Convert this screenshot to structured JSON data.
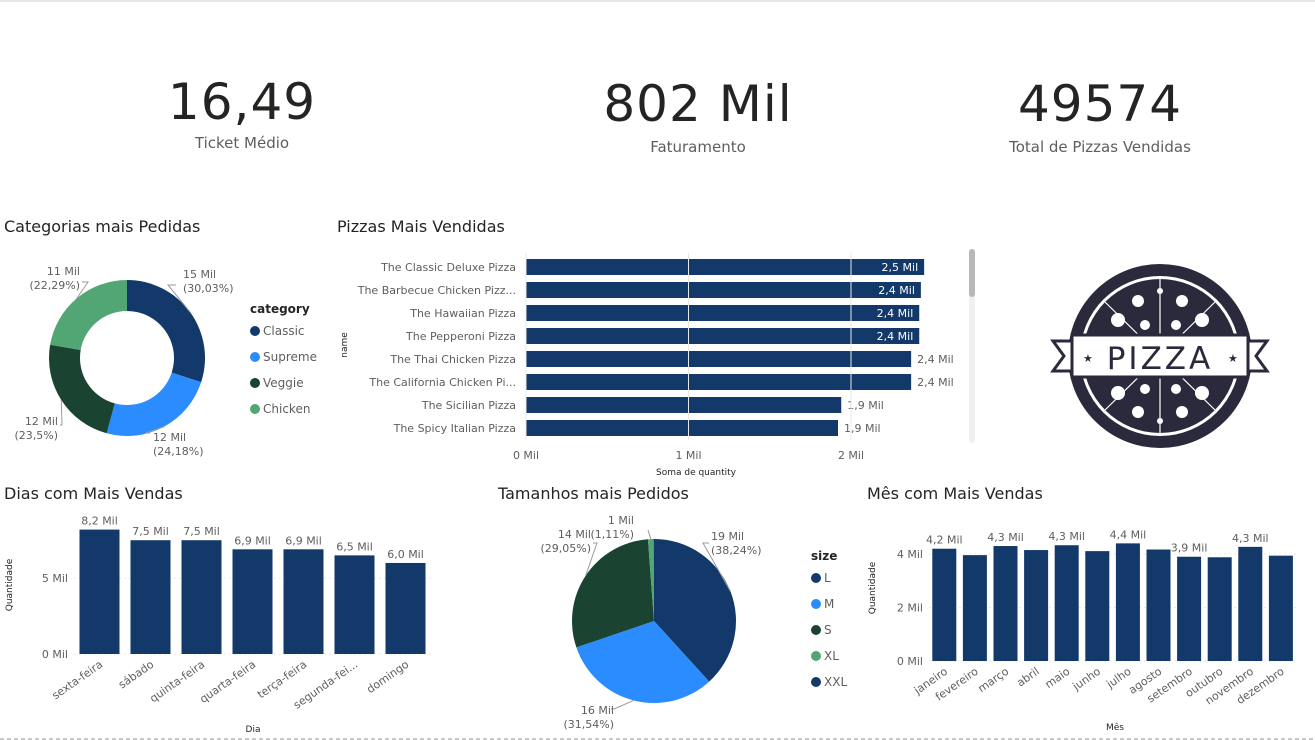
{
  "kpis": [
    {
      "value": "16,49",
      "label": "Ticket Médio"
    },
    {
      "value": "802 Mil",
      "label": "Faturamento"
    },
    {
      "value": "49574",
      "label": "Total de Pizzas Vendidas"
    }
  ],
  "colors": {
    "navy": "#12396a",
    "blue": "#2b8cff",
    "dark_green": "#1b4332",
    "green": "#52a673",
    "text": "#252423",
    "muted": "#605e5c"
  },
  "logo": {
    "text": "PIZZA"
  },
  "chart_data": [
    {
      "id": "categories",
      "type": "pie",
      "donut": true,
      "title": "Categorias mais Pedidas",
      "legend_title": "category",
      "legend_position": "right",
      "slices": [
        {
          "name": "Classic",
          "value": 15,
          "label_value": "15 Mil",
          "label_pct": "(30,03%)",
          "color": "#12396a"
        },
        {
          "name": "Supreme",
          "value": 12.08,
          "label_value": "12 Mil",
          "label_pct": "(24,18%)",
          "color": "#2b8cff"
        },
        {
          "name": "Veggie",
          "value": 11.75,
          "label_value": "12 Mil",
          "label_pct": "(23,5%)",
          "color": "#1b4332"
        },
        {
          "name": "Chicken",
          "value": 11.14,
          "label_value": "11 Mil",
          "label_pct": "(22,29%)",
          "color": "#52a673"
        }
      ]
    },
    {
      "id": "pizzas",
      "type": "bar",
      "orientation": "horizontal",
      "title": "Pizzas Mais Vendidas",
      "ylabel": "name",
      "xlabel": "Soma de quantity",
      "xlim": [
        0,
        2.5
      ],
      "xticks": [
        {
          "v": 0,
          "label": "0 Mil"
        },
        {
          "v": 1,
          "label": "1 Mil"
        },
        {
          "v": 2,
          "label": "2 Mil"
        }
      ],
      "categories": [
        "The Classic Deluxe Pizza",
        "The Barbecue Chicken Pizz...",
        "The Hawaiian Pizza",
        "The Pepperoni Pizza",
        "The Thai Chicken Pizza",
        "The California Chicken Pi...",
        "The Sicilian Pizza",
        "The Spicy Italian Pizza"
      ],
      "values": [
        2.45,
        2.43,
        2.42,
        2.42,
        2.37,
        2.37,
        1.94,
        1.92
      ],
      "labels": [
        "2,5 Mil",
        "2,4 Mil",
        "2,4 Mil",
        "2,4 Mil",
        "2,4 Mil",
        "2,4 Mil",
        "1,9 Mil",
        "1,9 Mil"
      ]
    },
    {
      "id": "days",
      "type": "bar",
      "title": "Dias com Mais Vendas",
      "xlabel": "Dia",
      "ylabel": "Quantidade",
      "ylim": [
        0,
        8.7
      ],
      "yticks": [
        {
          "v": 0,
          "label": "0 Mil"
        },
        {
          "v": 5,
          "label": "5 Mil"
        }
      ],
      "categories": [
        "sexta-feira",
        "sábado",
        "quinta-feira",
        "quarta-feira",
        "terça-feira",
        "segunda-fei...",
        "domingo"
      ],
      "values": [
        8.2,
        7.5,
        7.5,
        6.9,
        6.9,
        6.5,
        6.0
      ],
      "labels": [
        "8,2 Mil",
        "7,5 Mil",
        "7,5 Mil",
        "6,9 Mil",
        "6,9 Mil",
        "6,5 Mil",
        "6,0 Mil"
      ]
    },
    {
      "id": "sizes",
      "type": "pie",
      "title": "Tamanhos mais Pedidos",
      "legend_title": "size",
      "legend_position": "right",
      "slices": [
        {
          "name": "L",
          "value": 38.24,
          "label_value": "19 Mil",
          "label_pct": "(38,24%)",
          "color": "#12396a"
        },
        {
          "name": "M",
          "value": 31.54,
          "label_value": "16 Mil",
          "label_pct": "(31,54%)",
          "color": "#2b8cff"
        },
        {
          "name": "S",
          "value": 29.05,
          "label_value": "14 Mil",
          "label_pct": "(29,05%)",
          "color": "#1b4332"
        },
        {
          "name": "XL",
          "value": 1.11,
          "label_value": "1 Mil",
          "label_pct": "(1,11%)",
          "color": "#52a673"
        },
        {
          "name": "XXL",
          "value": 0.06,
          "label_value": "",
          "label_pct": "",
          "color": "#12396a"
        }
      ]
    },
    {
      "id": "months",
      "type": "bar",
      "title": "Mês com Mais Vendas",
      "xlabel": "Mês",
      "ylabel": "Quantidade",
      "ylim": [
        0,
        4.9
      ],
      "yticks": [
        {
          "v": 0,
          "label": "0 Mil"
        },
        {
          "v": 2,
          "label": "2 Mil"
        },
        {
          "v": 4,
          "label": "4 Mil"
        }
      ],
      "categories": [
        "janeiro",
        "fevereiro",
        "março",
        "abril",
        "maio",
        "junho",
        "julho",
        "agosto",
        "setembro",
        "outubro",
        "novembro",
        "dezembro"
      ],
      "values": [
        4.2,
        3.96,
        4.3,
        4.15,
        4.33,
        4.11,
        4.4,
        4.17,
        3.9,
        3.88,
        4.27,
        3.94
      ],
      "labels": [
        "4,2 Mil",
        "",
        "4,3 Mil",
        "",
        "4,3 Mil",
        "",
        "4,4 Mil",
        "",
        "3,9 Mil",
        "",
        "4,3 Mil",
        ""
      ]
    }
  ]
}
